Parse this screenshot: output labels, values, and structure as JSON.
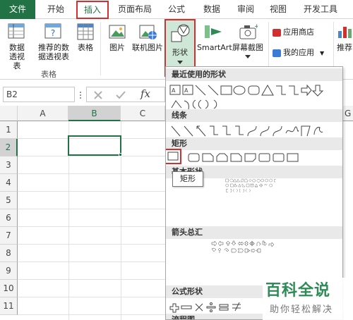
{
  "tabs": {
    "file": "文件",
    "home": "开始",
    "insert": "插入",
    "page_layout": "页面布局",
    "formulas": "公式",
    "data": "数据",
    "review": "审阅",
    "view": "视图",
    "developer": "开发工具"
  },
  "ribbon": {
    "pivot_table": "数据透视表",
    "recommended_pivot": "推荐的数据透视表",
    "table": "表格",
    "group_tables": "表格",
    "pictures": "图片",
    "online_pictures": "联机图片",
    "shapes": "形状",
    "smartart": "SmartArt",
    "screenshot": "屏幕截图",
    "app_store": "应用商店",
    "my_apps": "我的应用",
    "recommended": "推荐"
  },
  "formula_bar": {
    "name_box": "B2",
    "fx": "fx"
  },
  "grid": {
    "columns": [
      "A",
      "B",
      "C",
      "G"
    ],
    "rows": [
      "1",
      "2",
      "3",
      "4",
      "5",
      "6",
      "7",
      "8",
      "9",
      "10",
      "11"
    ],
    "selected_cell": "B2"
  },
  "shapes_panel": {
    "recent": "最近使用的形状",
    "lines": "线条",
    "rectangles": "矩形",
    "basic": "基本形状",
    "arrows": "箭头总汇",
    "equation": "公式形状",
    "flowchart": "流程图"
  },
  "tooltip": "矩形",
  "watermark": {
    "title": "百科全说",
    "subtitle": "助你轻松解决"
  },
  "colors": {
    "excel_green": "#217346",
    "highlight_red": "#d03030",
    "shape_btn_bg": "#cfe7d6"
  }
}
